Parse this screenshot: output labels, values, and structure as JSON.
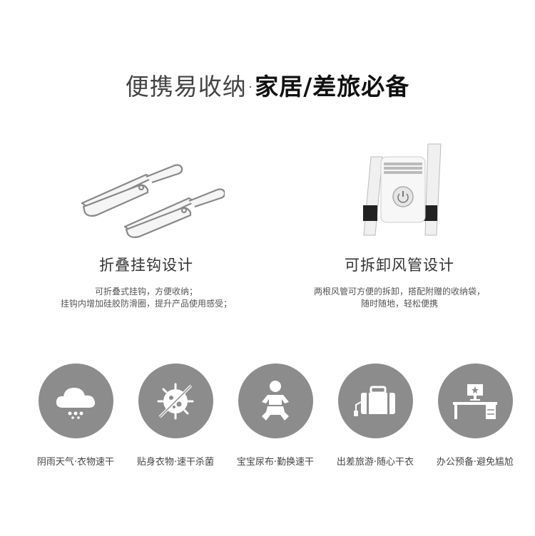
{
  "title": {
    "light": "便携易收纳·",
    "bold": "家居/差旅必备"
  },
  "features": [
    {
      "title": "折叠挂钩设计",
      "desc_line1": "可折叠式挂钩，方便收纳；",
      "desc_line2": "挂钩内增加硅胶防滑圈，提升产品使用感受；",
      "image": "folding-hooks-illustration"
    },
    {
      "title": "可拆卸风管设计",
      "desc_line1": "两根风管可方便的拆卸，搭配附赠的收纳袋，",
      "desc_line2": "随时随地，轻松便携",
      "image": "dryer-unit-illustration"
    }
  ],
  "icons": [
    {
      "label": "阴雨天气·衣物速干",
      "icon": "cloud-rain-icon"
    },
    {
      "label": "贴身衣物·速干杀菌",
      "icon": "no-bacteria-icon"
    },
    {
      "label": "宝宝尿布·勤换速干",
      "icon": "baby-icon"
    },
    {
      "label": "出差旅游·随心干衣",
      "icon": "suitcase-icon"
    },
    {
      "label": "办公预备·避免尴尬",
      "icon": "office-desk-icon"
    }
  ],
  "colors": {
    "circle": "#8c8c8c",
    "text": "#333333",
    "background": "#ffffff"
  }
}
